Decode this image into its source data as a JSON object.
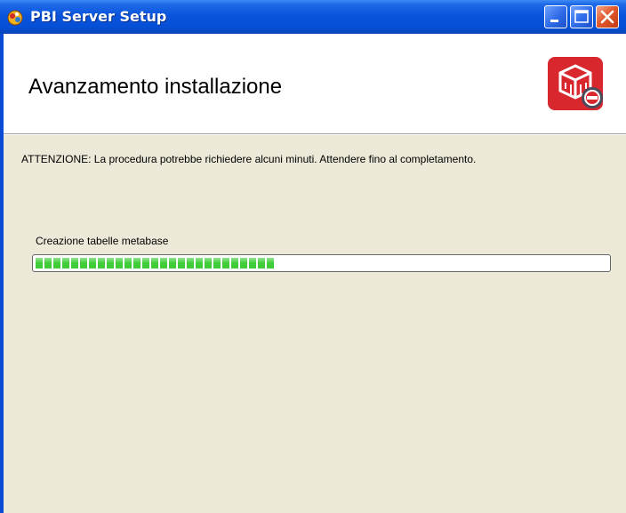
{
  "window": {
    "title": "PBI Server Setup",
    "controls": {
      "minimize": "minimize",
      "maximize": "maximize",
      "close": "close"
    }
  },
  "header": {
    "title": "Avanzamento installazione",
    "logo_icon": "setup-logo-icon"
  },
  "content": {
    "warning": "ATTENZIONE: La procedura potrebbe richiedere alcuni minuti. Attendere fino al completamento.",
    "status_label": "Creazione tabelle metabase",
    "progress_fraction": 0.42
  },
  "colors": {
    "titlebar": "#0a54dc",
    "content_background": "#ece9d8",
    "progress_fill": "#3ecd38",
    "close_button": "#e25a2e"
  }
}
